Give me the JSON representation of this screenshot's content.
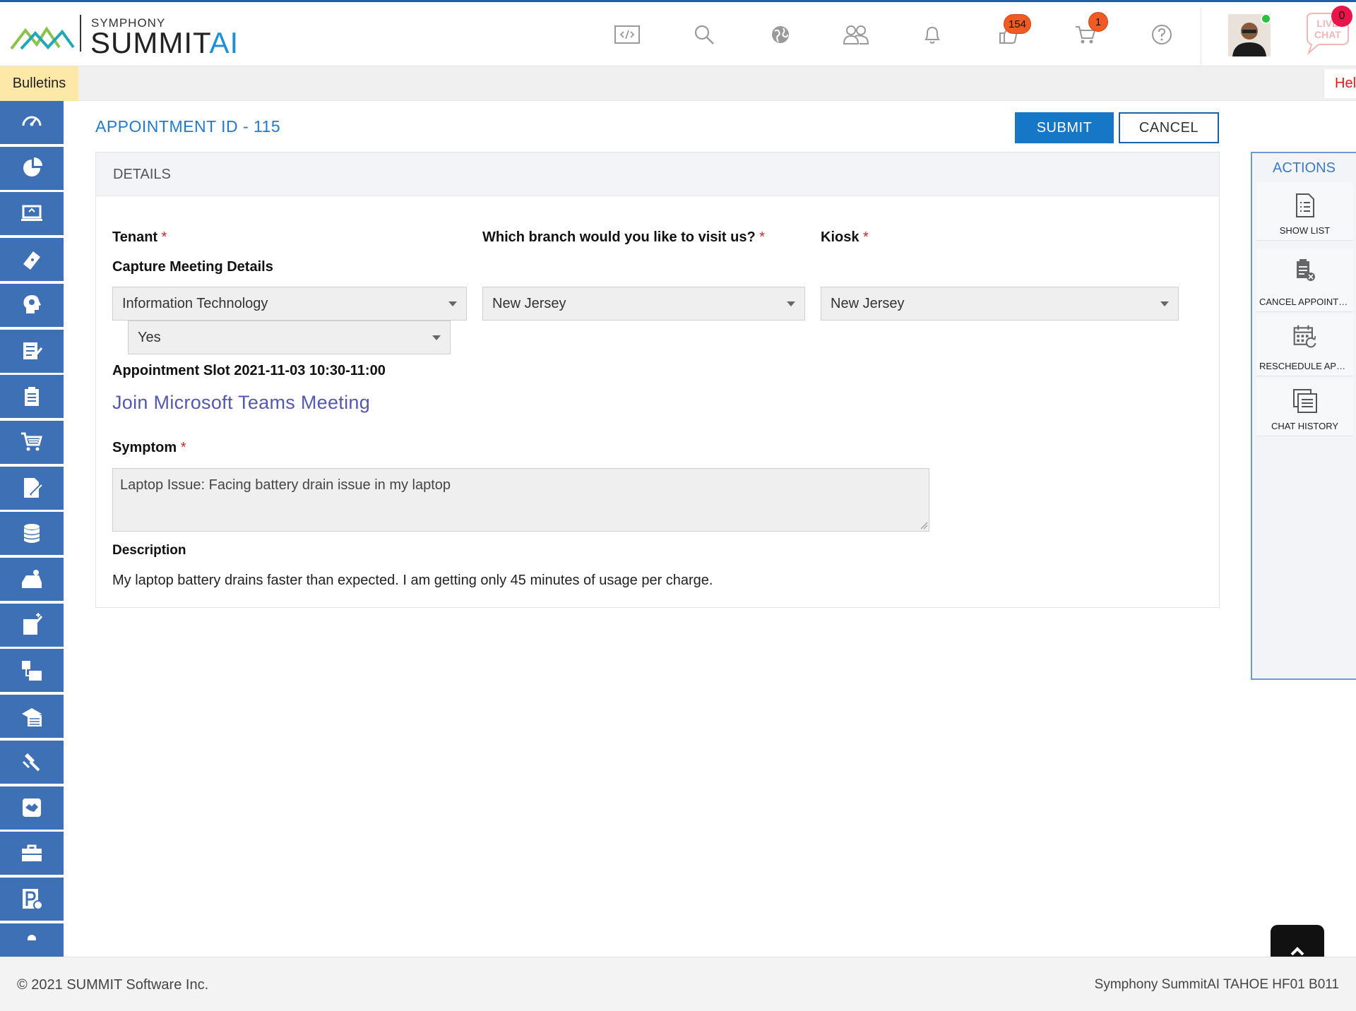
{
  "header": {
    "brand_small": "SYMPHONY",
    "brand_main": "SUMMIT",
    "brand_ai": "AI",
    "icons": [
      "code-icon",
      "search-icon",
      "globe-icon",
      "users-icon",
      "bell-icon",
      "thumbs-icon",
      "cart-icon",
      "help-icon"
    ],
    "thumbs_badge": "154",
    "cart_badge": "1",
    "livechat_label_1": "LIVE",
    "livechat_label_2": "CHAT",
    "livechat_badge": "0"
  },
  "bulletins": {
    "tab_label": "Bulletins",
    "right_label": "Hel"
  },
  "sidebar": {
    "items": [
      "dashboard-icon",
      "pie-chart-icon",
      "laptop-icon",
      "ticket-icon",
      "head-gear-icon",
      "checklist-icon",
      "clipboard-icon",
      "cart-icon",
      "document-edit-icon",
      "database-icon",
      "scanner-icon",
      "edit-box-icon",
      "workflow-icon",
      "stack-icon",
      "gavel-icon",
      "handshake-icon",
      "briefcase-icon",
      "parking-icon",
      "person-icon"
    ]
  },
  "page": {
    "title": "APPOINTMENT ID - 115",
    "submit_label": "SUBMIT",
    "cancel_label": "CANCEL"
  },
  "details": {
    "section_title": "DETAILS",
    "tenant_label": "Tenant",
    "branch_label": "Which branch would you like to visit us?",
    "kiosk_label": "Kiosk",
    "capture_label": "Capture Meeting Details",
    "tenant_value": "Information Technology",
    "branch_value": "New Jersey",
    "kiosk_value": "New Jersey",
    "capture_value": "Yes",
    "slot_text": "Appointment Slot 2021-11-03 10:30-11:00",
    "teams_link": "Join Microsoft Teams Meeting",
    "symptom_label": "Symptom",
    "symptom_value": "Laptop Issue: Facing battery drain issue in my laptop",
    "description_label": "Description",
    "description_value": "My laptop battery drains faster than expected. I am getting only 45 minutes of usage per charge.",
    "required_mark": "*"
  },
  "actions": {
    "title": "ACTIONS",
    "items": [
      {
        "label": "SHOW LIST",
        "icon": "list-document-icon"
      },
      {
        "label": "CANCEL APPOINTMENT",
        "icon": "cancel-appointment-icon"
      },
      {
        "label": "RESCHEDULE APPOINTMENT",
        "icon": "reschedule-calendar-icon"
      },
      {
        "label": "CHAT HISTORY",
        "icon": "chat-history-icon"
      }
    ]
  },
  "footer": {
    "copyright": "© 2021 SUMMIT Software Inc.",
    "version": "Symphony SummitAI TAHOE HF01 B011"
  },
  "colors": {
    "accent": "#1677c7",
    "sidebar": "#3d70b5",
    "link": "#5558af",
    "badge": "#f15a22",
    "required": "#c62828"
  }
}
